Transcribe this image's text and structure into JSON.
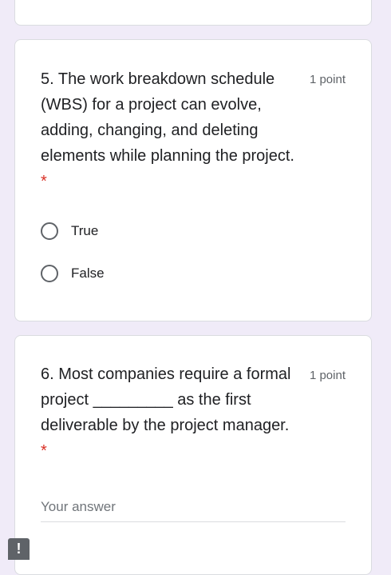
{
  "questions": [
    {
      "number_text": "5. The work breakdown schedule (WBS) for a project can evolve, adding, changing, and deleting elements while planning the project.",
      "required_mark": "*",
      "points": "1 point",
      "options": [
        {
          "label": "True"
        },
        {
          "label": "False"
        }
      ]
    },
    {
      "number_text": "6. Most companies require a formal project _________ as the first deliverable by the project manager.",
      "required_mark": "*",
      "points": "1 point",
      "answer_placeholder": "Your answer"
    }
  ],
  "feedback_button": {
    "glyph": "!"
  }
}
